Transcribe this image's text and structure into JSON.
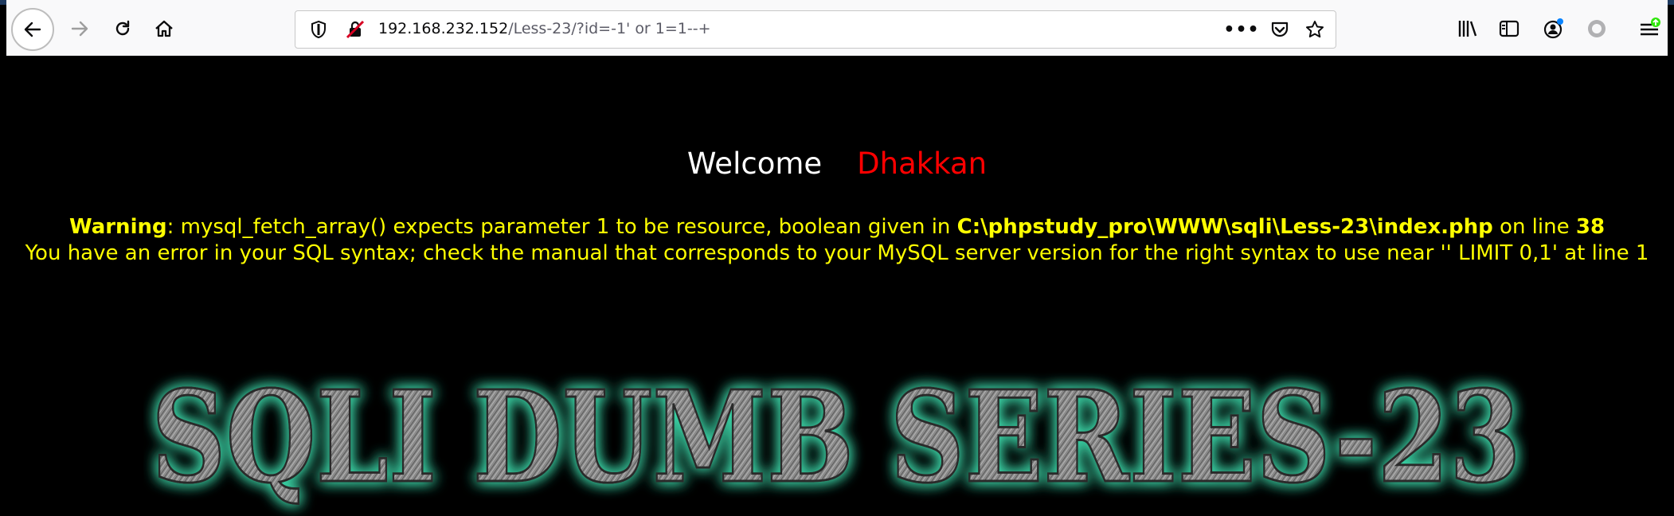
{
  "browser": {
    "url_host": "192.168.232.152",
    "url_path": "/Less-23/?id=-1' or 1=1--+",
    "more_label": "•••"
  },
  "page": {
    "welcome_label": "Welcome",
    "welcome_name": "Dhakkan",
    "warning": {
      "label": "Warning",
      "text1": ": mysql_fetch_array() expects parameter 1 to be resource, boolean given in ",
      "file": "C:\\phpstudy_pro\\WWW\\sqli\\Less-23\\index.php",
      "text2": " on line ",
      "line": "38",
      "sql_error": "You have an error in your SQL syntax; check the manual that corresponds to your MySQL server version for the right syntax to use near '' LIMIT 0,1' at line 1"
    },
    "banner_text": "SQLI DUMB SERIES-23"
  },
  "colors": {
    "welcome_label": "#ffffff",
    "welcome_name": "#ff0000",
    "warning": "#ffff00",
    "banner_glow": "#3fe0b0"
  },
  "icons": [
    "back-arrow-icon",
    "forward-arrow-icon",
    "reload-icon",
    "home-icon",
    "shield-icon",
    "insecure-connection-icon",
    "more-icon",
    "pocket-icon",
    "star-icon",
    "library-icon",
    "sidebar-icon",
    "account-icon",
    "sync-icon",
    "menu-icon"
  ]
}
